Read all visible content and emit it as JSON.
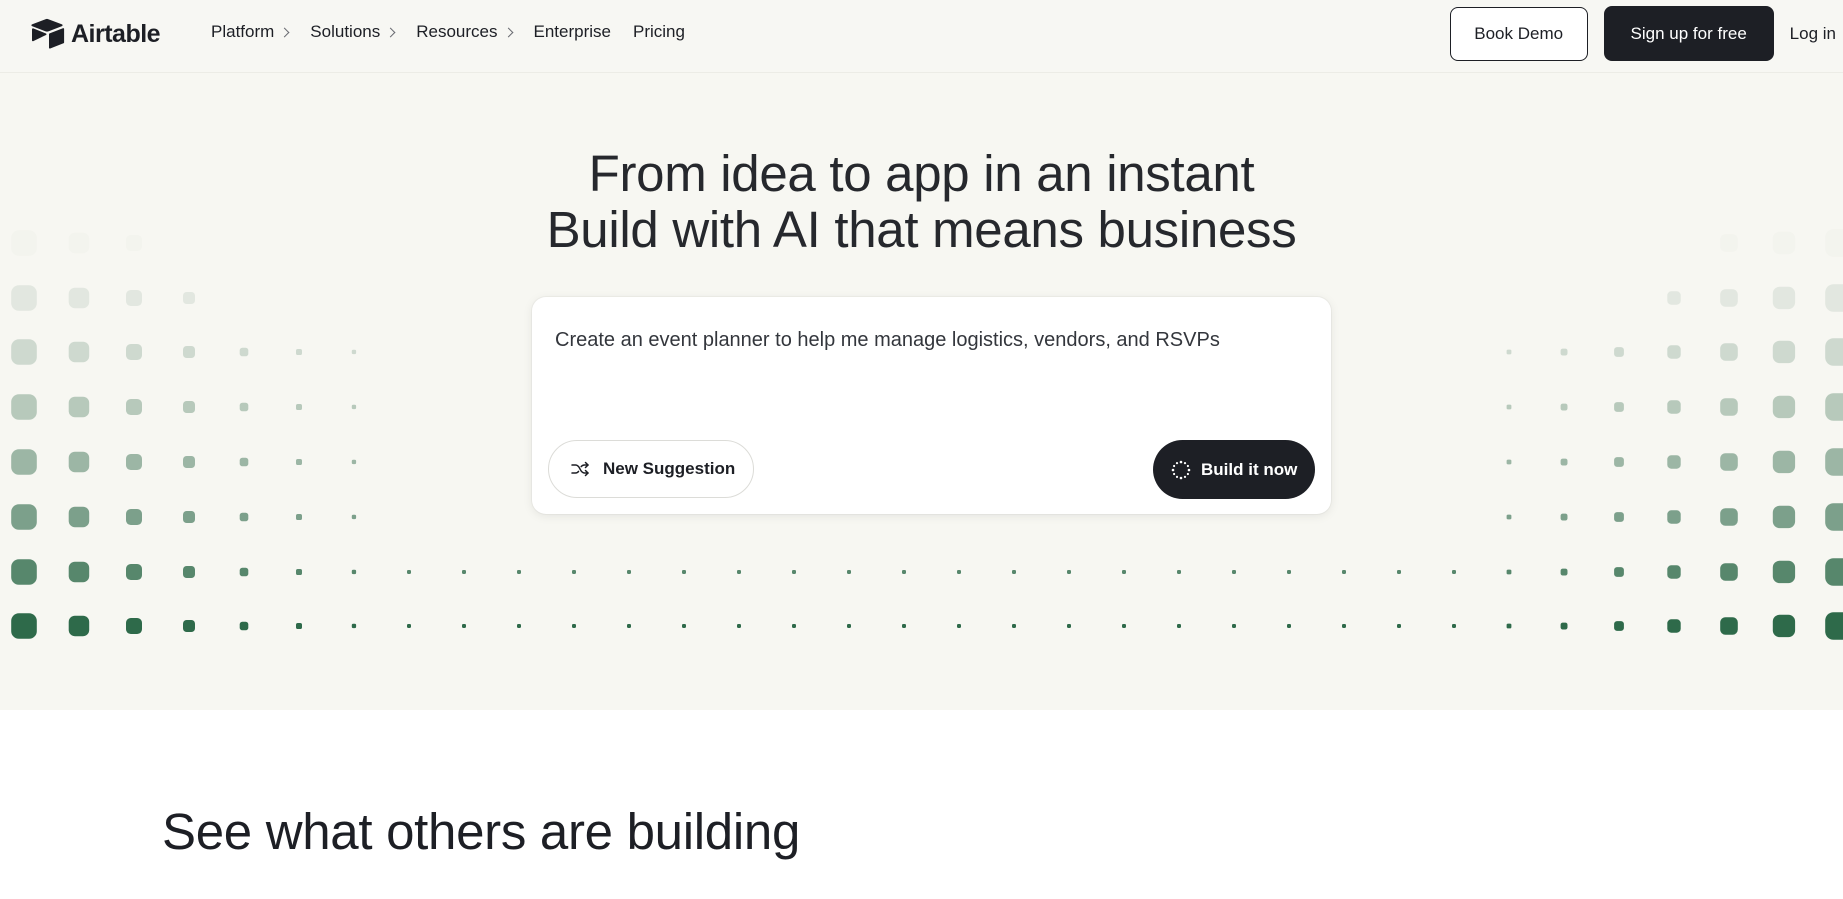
{
  "brand": {
    "name": "Airtable"
  },
  "nav": {
    "items": [
      {
        "label": "Platform",
        "has_submenu": true
      },
      {
        "label": "Solutions",
        "has_submenu": true
      },
      {
        "label": "Resources",
        "has_submenu": true
      },
      {
        "label": "Enterprise",
        "has_submenu": false
      },
      {
        "label": "Pricing",
        "has_submenu": false
      }
    ],
    "book_demo": "Book Demo",
    "sign_up": "Sign up for free",
    "log_in": "Log in"
  },
  "hero": {
    "title_line1": "From idea to app in an instant",
    "title_line2": "Build with AI that means business",
    "prompt": "Create an event planner to help me manage logistics, vendors, and RSVPs",
    "new_suggestion": "New Suggestion",
    "build_it_now": "Build it now"
  },
  "section": {
    "title": "See what others are building"
  },
  "colors": {
    "accent_green": "#2e6a4a",
    "dark": "#1d1f25",
    "hero_bg": "#f7f7f2"
  },
  "icons": {
    "logo": "airtable-logo-icon",
    "shuffle": "shuffle-icon",
    "spinner": "sparkle-spinner-icon",
    "chevron": "chevron-right-icon"
  }
}
